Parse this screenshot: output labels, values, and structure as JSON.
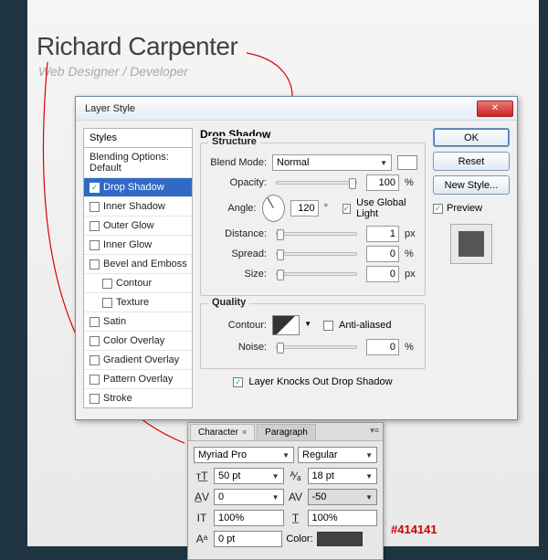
{
  "header": {
    "name": "Richard Carpenter",
    "sub": "Web Designer / Developer"
  },
  "layerStyle": {
    "title": "Layer Style",
    "stylesHead": "Styles",
    "items": [
      {
        "label": "Blending Options: Default",
        "checkbox": false,
        "checked": false,
        "indent": false,
        "selected": false
      },
      {
        "label": "Drop Shadow",
        "checkbox": true,
        "checked": true,
        "indent": false,
        "selected": true
      },
      {
        "label": "Inner Shadow",
        "checkbox": true,
        "checked": false,
        "indent": false,
        "selected": false
      },
      {
        "label": "Outer Glow",
        "checkbox": true,
        "checked": false,
        "indent": false,
        "selected": false
      },
      {
        "label": "Inner Glow",
        "checkbox": true,
        "checked": false,
        "indent": false,
        "selected": false
      },
      {
        "label": "Bevel and Emboss",
        "checkbox": true,
        "checked": false,
        "indent": false,
        "selected": false
      },
      {
        "label": "Contour",
        "checkbox": true,
        "checked": false,
        "indent": true,
        "selected": false
      },
      {
        "label": "Texture",
        "checkbox": true,
        "checked": false,
        "indent": true,
        "selected": false
      },
      {
        "label": "Satin",
        "checkbox": true,
        "checked": false,
        "indent": false,
        "selected": false
      },
      {
        "label": "Color Overlay",
        "checkbox": true,
        "checked": false,
        "indent": false,
        "selected": false
      },
      {
        "label": "Gradient Overlay",
        "checkbox": true,
        "checked": false,
        "indent": false,
        "selected": false
      },
      {
        "label": "Pattern Overlay",
        "checkbox": true,
        "checked": false,
        "indent": false,
        "selected": false
      },
      {
        "label": "Stroke",
        "checkbox": true,
        "checked": false,
        "indent": false,
        "selected": false
      }
    ],
    "sectionTitle": "Drop Shadow",
    "structure": {
      "title": "Structure",
      "blendModeLabel": "Blend Mode:",
      "blendMode": "Normal",
      "opacityLabel": "Opacity:",
      "opacity": "100",
      "opacityUnit": "%",
      "angleLabel": "Angle:",
      "angle": "120",
      "angleUnit": "°",
      "globalLight": "Use Global Light",
      "distanceLabel": "Distance:",
      "distance": "1",
      "distanceUnit": "px",
      "spreadLabel": "Spread:",
      "spread": "0",
      "spreadUnit": "%",
      "sizeLabel": "Size:",
      "size": "0",
      "sizeUnit": "px"
    },
    "quality": {
      "title": "Quality",
      "contourLabel": "Contour:",
      "antiAlias": "Anti-aliased",
      "noiseLabel": "Noise:",
      "noise": "0",
      "noiseUnit": "%"
    },
    "knockOut": "Layer Knocks Out Drop Shadow",
    "buttons": {
      "ok": "OK",
      "reset": "Reset",
      "newStyle": "New Style...",
      "preview": "Preview"
    }
  },
  "character": {
    "tab1": "Character",
    "tab2": "Paragraph",
    "font": "Myriad Pro",
    "weight": "Regular",
    "fontSize": "50 pt",
    "leading": "18 pt",
    "kerning": "0",
    "tracking": "-50",
    "hscale": "100%",
    "vscale": "100%",
    "baseline": "0 pt",
    "colorLabel": "Color:",
    "colorHex": "#414141"
  }
}
